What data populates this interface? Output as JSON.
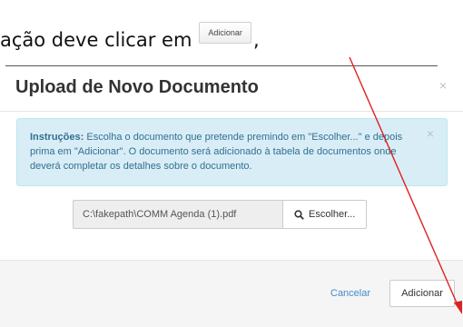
{
  "document_text": {
    "sentence": "ação deve clicar em",
    "inline_button": "Adicionar",
    "trailing": ","
  },
  "modal": {
    "title": "Upload de Novo Documento",
    "close_symbol": "×",
    "alert": {
      "label": "Instruções:",
      "text": " Escolha o documento que pretende premindo em \"Escolher...\" e depois prima em \"Adicionar\". O documento será adicionado à tabela de documentos onde deverá completar os detalhes sobre o documento.",
      "close_symbol": "×"
    },
    "file_path": "C:\\fakepath\\COMM Agenda (1).pdf",
    "choose_button": "Escolher...",
    "cancel_label": "Cancelar",
    "add_label": "Adicionar"
  },
  "colors": {
    "annotation_arrow": "#e02020",
    "alert_background": "#d9edf7",
    "link": "#428bca"
  },
  "icons": {
    "choose": "search-icon"
  }
}
